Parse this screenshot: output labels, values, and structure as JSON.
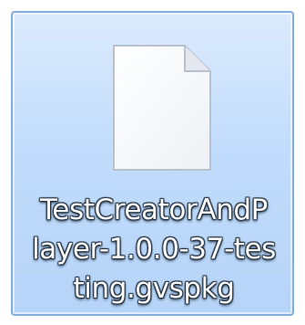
{
  "file": {
    "name_lines": [
      "TestCreatorAndP",
      "layer-1.0.0-37-tes",
      "ting.gvspkg"
    ],
    "icon": "blank-document-icon"
  },
  "colors": {
    "selection_border": "#84acdd",
    "selection_fill_top": "#dcebfc",
    "selection_fill_bottom": "#b6d4f8",
    "label_text": "#ffffff",
    "label_shadow": "#1d2b3a"
  }
}
